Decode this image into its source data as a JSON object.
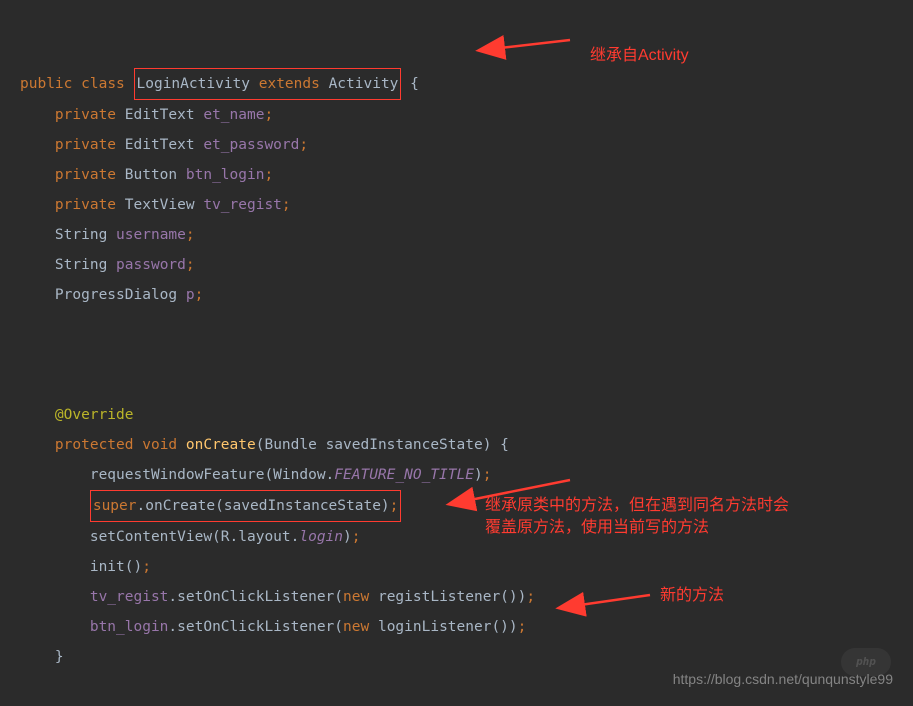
{
  "code": {
    "l1_public": "public",
    "l1_class": "class",
    "l1_box": "LoginActivity extends Activity",
    "l1_brace": "{",
    "l2_priv": "private",
    "l2_type": "EditText",
    "l2_name": "et_name",
    "l3_priv": "private",
    "l3_type": "EditText",
    "l3_name": "et_password",
    "l4_priv": "private",
    "l4_type": "Button",
    "l4_name": "btn_login",
    "l5_priv": "private",
    "l5_type": "TextView",
    "l5_name": "tv_regist",
    "l6_type": "String",
    "l6_name": "username",
    "l7_type": "String",
    "l7_name": "password",
    "l8_type": "ProgressDialog",
    "l8_name": "p",
    "override": "@Override",
    "l9_prot": "protected",
    "l9_void": "void",
    "l9_method": "onCreate",
    "l9_param": "(Bundle savedInstanceState) {",
    "l10": "requestWindowFeature(Window.",
    "l10_const": "FEATURE_NO_TITLE",
    "l10_end": ")",
    "l11_box_super": "super",
    "l11_box_rest": ".onCreate(savedInstanceState)",
    "l12_a": "setContentView(R.layout.",
    "l12_login": "login",
    "l12_b": ")",
    "l13": "init()",
    "l14_a": "tv_regist",
    "l14_b": ".setOnClickListener(",
    "l14_new": "new",
    "l14_c": " registListener())",
    "l15_a": "btn_login",
    "l15_b": ".setOnClickListener(",
    "l15_new": "new",
    "l15_c": " loginListener())"
  },
  "annotations": {
    "a1": "继承自Activity",
    "a2_line1": "继承原类中的方法，但在遇到同名方法时会",
    "a2_line2": "覆盖原方法，使用当前写的方法",
    "a3": "新的方法"
  },
  "watermark": "https://blog.csdn.net/qunqunstyle99",
  "php": "php"
}
